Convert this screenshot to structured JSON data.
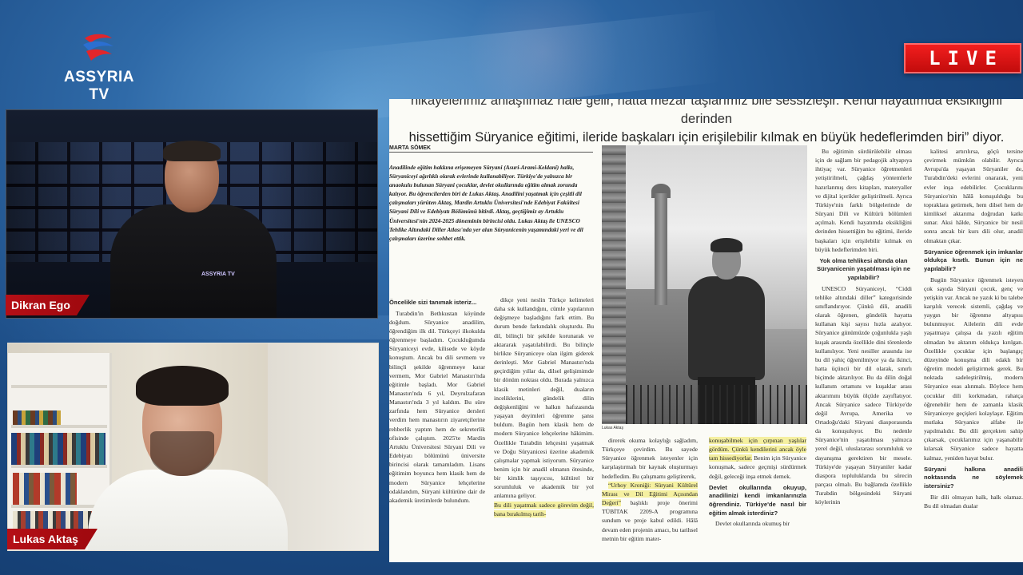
{
  "brand": {
    "logo_text": "ASSYRIA TV",
    "live_label": "LIVE",
    "shirt_logo_text": "ASSYRIA TV",
    "colors": {
      "live_red": "#d41414",
      "nametag_red": "#b50f16",
      "logo_blue": "#2b6fd1",
      "logo_red": "#e2262b"
    }
  },
  "participants": [
    {
      "name": "Dikran Ego"
    },
    {
      "name": "Lukas Aktaş"
    }
  ],
  "article": {
    "headline_line1": "hikayelerimiz anlaşılmaz hale gelir, hatta mezar taşlarımız bile sessizleşir. Kendi hayatımda eksikliğini derinden",
    "headline_line2": "hissettiğim Süryanice eğitimi, ileride başkaları için erişilebilir kılmak en büyük hedeflerimden biri” diyor.",
    "byline": "MARTA SÖMEK",
    "intro": "Anadilinde eğitim hakkına erişemeyen Süryani (Asuri-Arami-Keldani) halkı, Süryaniceyi ağırlıklı olarak evlerinde kullanabiliyor. Türkiye'de yalnızca bir anaokulu bulunan Süryani çocuklar, devlet okullarında eğitim almak zorunda kalıyor. Bu öğrencilerden biri de Lukas Aktaş. Anadilini yaşatmak için çeşitli dil çalışmaları yürüten Aktaş, Mardin Artuklu Üniversitesi'nde Edebiyat Fakültesi Süryani Dili ve Edebiyatı Bölümünü bitirdi. Aktaş, geçtiğimiz ay Artuklu Üniversitesi'nin 2024-2025 döneminin birincisi oldu. Lukas Aktaş ile UNESCO Tehlike Altındaki Diller Atlası'nda yer alan Süryanicenin yaşamındaki yeri ve dil çalışmaları üzerine sohbet ettik.",
    "photo_caption": "Lukas Aktaş",
    "col1_question": "Öncelikle sizi tanımak isteriz...",
    "col1_text": "Turabdin'in Bethkustan köyünde doğdum. Süryanice anadilim, öğrendiğim ilk dil. Türkçeyi ilkokulda öğrenmeye başladım. Çocukluğumda Süryaniceyi evde, kilisede ve köyde konuştum. Ancak bu dili sevmem ve bilinçli şekilde öğrenmeye karar vermem, Mor Gabriel Manastırı'nda eğitimle başladı. Mor Gabriel Manastırı'nda 6 yıl, Deyrulzafaran Manastırı'nda 3 yıl kaldım. Bu süre zarfında hem Süryanice dersleri verdim hem manastırın ziyaretçilerine rehberlik yaptım hem de sekreterlik ofisinde çalıştım. 2025'te Mardin Artuklu Üniversitesi Süryani Dili ve Edebiyatı bölümünü üniversite birincisi olarak tamamladım. Lisans eğitimim boyunca hem klasik hem de modern Süryanice lehçelerine odaklandım, Süryani kültürüne dair de akademik üretimlerde bulundum.",
    "col2_text": "dikçe yeni neslin Türkçe kelimeleri daha sık kullandığını, cümle yapılarının değişmeye başladığını fark ettim. Bu durum bende farkındalık oluşturdu. Bu dil, bilinçli bir şekilde korunarak ve aktararak yaşatılabilirdi. Bu bilinçle birlikte Süryaniceye olan ilgim giderek derinleşti. Mor Gabriel Manastırı'nda geçirdiğim yıllar da, dilsel gelişimimde bir dönüm noktası oldu. Burada yalnızca klasik metinleri değil, duaların inceliklerini, gündelik dilin değişkenliğini ve halkın hafızasında yaşayan deyimleri öğrenme şansı buldum. Bugün hem klasik hem de modern Süryanice lehçelerine hâkimim. Özellikle Turabdin lehçesini yaşatmak ve Doğu Süryanicesi üzerine akademik çalışmalar yapmak istiyorum. Süryanice benim için bir anadil olmanın ötesinde, bir kimlik taşıyıcısı, kültürel bir sorumluluk ve akademik bir yol anlamına geliyor.",
    "col2_highlight": "Bu dili yaşatmak sadece görevim değil, bana bırakılmış tarih-",
    "col3_text": "direrek okuma kolaylığı sağladım, Türkçeye çevirdim. Bu sayede Süryanice öğrenmek isteyenler için karşılaştırmalı bir kaynak oluşturmayı hedefledim. Bu çalışmamı geliştirerek,",
    "col3_highlight": "“Urhoy Kroniği: Süryani Kültürel Mirası ve Dil Eğitimi Açısından Değeri”",
    "col3_text2": "başlıklı proje önerimi TÜBİTAK 2209-A programına sundum ve proje kabul edildi. Hâlâ devam eden projenin amacı, bu tarihsel metnin bir eğitim mater-",
    "col4_highlight": "konuşabilmek için çırpınan yaşlılar gördüm. Çünkü kendilerini ancak öyle tam hissediyorlar.",
    "col4_text": "Benim için Süryanice konuşmak, sadece geçmişi sürdürmek değil, geleceği inşa etmek demek.",
    "col4_question": "Devlet okullarında okuyup, anadilinizi kendi imkanlarınızla öğrendiniz. Türkiye'de nasıl bir eğitim almak isterdiniz?",
    "col4_text2": "Devlet okullarında okumuş bir",
    "col5_text": "Bu eğitimin sürdürülebilir olması için de sağlam bir pedagojik altyapıya ihtiyaç var. Süryanice öğretmenleri yetiştirilmeli, çağdaş yöntemlerle hazırlanmış ders kitapları, materyaller ve dijital içerikler geliştirilmeli. Ayrıca Türkiye'nin farklı bölgelerinde de Süryani Dili ve Kültürü bölümleri açılmalı. Kendi hayatımda eksikliğini derinden hissettiğim bu eğitimi, ileride başkaları için erişilebilir kılmak en büyük hedeflerimden biri.",
    "col5_question": "Yok olma tehlikesi altında olan Süryanicenin yaşatılması için ne yapılabilir?",
    "col5_text2": "UNESCO Süryaniceyi, “Ciddi tehlike altındaki diller” kategorisinde sınıflandırıyor. Çünkü dili, anadili olarak öğrenen, gündelik hayatta kullanan kişi sayısı hızla azalıyor. Süryanice günümüzde çoğunlukla yaşlı kuşak arasında özellikle dini törenlerde kullanılıyor. Yeni nesiller arasında ise bu dil yahiç öğrenilmiyor ya da ikinci, hatta üçüncü bir dil olarak, sınırlı biçimde aktarılıyor. Bu da dilin doğal kullanım ortamını ve kuşaklar arası aktarımını büyük ölçüde zayıflatıyor. Ancak Süryanice sadece Türkiye'de değil Avrupa, Amerika ve Ortadoğu'daki Süryani diasporasında da konuşuluyor. Bu nedenle Süryanice'nin yaşatılması yalnızca yerel değil, uluslararası sorumluluk ve dayanışma gerektiren bir mesele. Türkiye'de yaşayan Süryaniler kadar diaspora topluluklarıda bu sürecin parçası olmalı. Bu bağlamda özellikle Turabdin bölgesindeki Süryani köylerinin",
    "col6_text": "kalitesi artırılırsa, göçü tersine çevirmek mümkün olabilir. Ayrıca Avrupa'da yaşayan Süryaniler de, Turabdin'deki evlerini onararak, yeni evler inşa edebilirler. Çocuklarını Süryanice'nin hâlâ konuşulduğu bu topraklara getirmek, hem dilsel hem de kimliksel aktarıma doğrudan katkı sunar. Aksi hâlde, Süryanice bir nesil sonra ancak bir kurs dili olur, anadil olmaktan çıkar.",
    "col6_question": "Süryanice öğrenmek için imkanlar oldukça kısıtlı. Bunun için ne yapılabilir?",
    "col6_text2": "Bugün Süryanice öğrenmek isteyen çok sayıda Süryani çocuk, genç ve yetişkin var. Ancak ne yazık ki bu talebe karşılık verecek sistemli, çağdaş ve yaygın bir öğrenme altyapısı bulunmuyor. Ailelerin dili evde yaşatmaya çalışsa da yazılı eğitim olmadan bu aktarım oldukça kırılgan. Özellikle çocuklar için başlangıç düzeyinde konuşma dili odaklı bir öğretim modeli geliştirmek gerek. Bu noktada sadeleştirilmiş, modern Süryanice esas alınmalı. Böylece hem çocuklar dili korkmadan, rahatça öğrenebilir hem de zamanla klasik Süryaniceye geçişleri kolaylaşır. Eğitim mutlaka Süryanice alfabe ile yapılmalıdır. Bu dili gerçekten sahip çıkarsak, çocuklarımız için yaşanabilir kılarsak Süryanice sadece hayatta kalmaz, yeniden hayat bulur.",
    "col6_question2": "Süryani halkına anadili noktasında ne söylemek istersiniz?",
    "col6_text3": "Bir dili olmayan halk, halk olamaz. Bu dil olmadan dualar"
  }
}
